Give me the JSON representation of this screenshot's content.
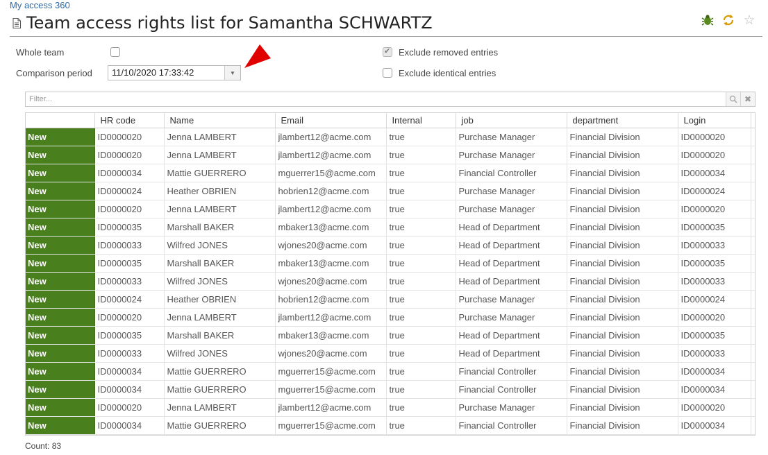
{
  "breadcrumb": "My access 360",
  "page_title": "Team access rights list for Samantha SCHWARTZ",
  "form": {
    "whole_team_label": "Whole team",
    "whole_team_checked": false,
    "comparison_period_label": "Comparison period",
    "comparison_period_value": "11/10/2020 17:33:42",
    "exclude_removed_label": "Exclude removed entries",
    "exclude_removed_checked": true,
    "exclude_identical_label": "Exclude identical entries",
    "exclude_identical_checked": false
  },
  "filter": {
    "placeholder": "Filter..."
  },
  "table": {
    "columns": [
      "",
      "HR code",
      "Name",
      "Email",
      "Internal",
      "job",
      "department",
      "Login",
      ""
    ],
    "rows": [
      [
        "New",
        "ID0000020",
        "Jenna LAMBERT",
        "jlambert12@acme.com",
        "true",
        "Purchase Manager",
        "Financial Division",
        "ID0000020"
      ],
      [
        "New",
        "ID0000020",
        "Jenna LAMBERT",
        "jlambert12@acme.com",
        "true",
        "Purchase Manager",
        "Financial Division",
        "ID0000020"
      ],
      [
        "New",
        "ID0000034",
        "Mattie GUERRERO",
        "mguerrer15@acme.com",
        "true",
        "Financial Controller",
        "Financial Division",
        "ID0000034"
      ],
      [
        "New",
        "ID0000024",
        "Heather OBRIEN",
        "hobrien12@acme.com",
        "true",
        "Purchase Manager",
        "Financial Division",
        "ID0000024"
      ],
      [
        "New",
        "ID0000020",
        "Jenna LAMBERT",
        "jlambert12@acme.com",
        "true",
        "Purchase Manager",
        "Financial Division",
        "ID0000020"
      ],
      [
        "New",
        "ID0000035",
        "Marshall BAKER",
        "mbaker13@acme.com",
        "true",
        "Head of Department",
        "Financial Division",
        "ID0000035"
      ],
      [
        "New",
        "ID0000033",
        "Wilfred JONES",
        "wjones20@acme.com",
        "true",
        "Head of Department",
        "Financial Division",
        "ID0000033"
      ],
      [
        "New",
        "ID0000035",
        "Marshall BAKER",
        "mbaker13@acme.com",
        "true",
        "Head of Department",
        "Financial Division",
        "ID0000035"
      ],
      [
        "New",
        "ID0000033",
        "Wilfred JONES",
        "wjones20@acme.com",
        "true",
        "Head of Department",
        "Financial Division",
        "ID0000033"
      ],
      [
        "New",
        "ID0000024",
        "Heather OBRIEN",
        "hobrien12@acme.com",
        "true",
        "Purchase Manager",
        "Financial Division",
        "ID0000024"
      ],
      [
        "New",
        "ID0000020",
        "Jenna LAMBERT",
        "jlambert12@acme.com",
        "true",
        "Purchase Manager",
        "Financial Division",
        "ID0000020"
      ],
      [
        "New",
        "ID0000035",
        "Marshall BAKER",
        "mbaker13@acme.com",
        "true",
        "Head of Department",
        "Financial Division",
        "ID0000035"
      ],
      [
        "New",
        "ID0000033",
        "Wilfred JONES",
        "wjones20@acme.com",
        "true",
        "Head of Department",
        "Financial Division",
        "ID0000033"
      ],
      [
        "New",
        "ID0000034",
        "Mattie GUERRERO",
        "mguerrer15@acme.com",
        "true",
        "Financial Controller",
        "Financial Division",
        "ID0000034"
      ],
      [
        "New",
        "ID0000034",
        "Mattie GUERRERO",
        "mguerrer15@acme.com",
        "true",
        "Financial Controller",
        "Financial Division",
        "ID0000034"
      ],
      [
        "New",
        "ID0000020",
        "Jenna LAMBERT",
        "jlambert12@acme.com",
        "true",
        "Purchase Manager",
        "Financial Division",
        "ID0000020"
      ],
      [
        "New",
        "ID0000034",
        "Mattie GUERRERO",
        "mguerrer15@acme.com",
        "true",
        "Financial Controller",
        "Financial Division",
        "ID0000034"
      ]
    ]
  },
  "count_label": "Count: 83",
  "icons": [
    "document-icon",
    "bug-icon",
    "refresh-icon",
    "star-icon",
    "chevron-down-icon",
    "search-icon",
    "clear-icon",
    "red-arrow-marker"
  ],
  "colors": {
    "status_new": "#4a7f1e",
    "link": "#2f6aa3",
    "annotation_arrow": "#e00000"
  }
}
